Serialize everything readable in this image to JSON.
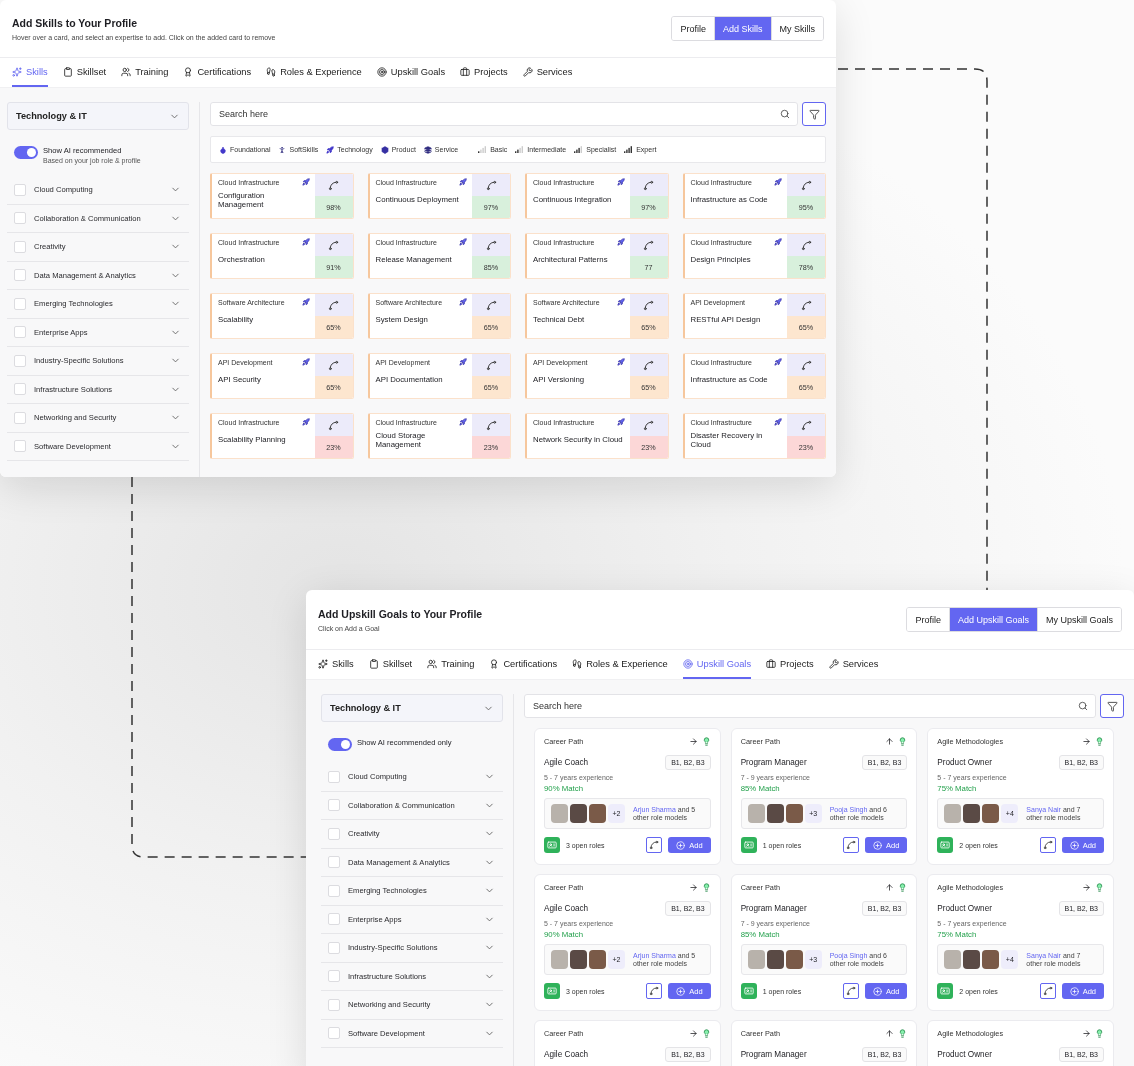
{
  "skills_window": {
    "title": "Add Skills to Your Profile",
    "subtitle": "Hover over a card, and select an expertise to add. Click on the added card to remove",
    "view_switch": [
      {
        "label": "Profile",
        "selected": false
      },
      {
        "label": "Add Skills",
        "selected": true
      },
      {
        "label": "My Skills",
        "selected": false
      }
    ],
    "tabs": [
      {
        "label": "Skills",
        "selected": true
      },
      {
        "label": "Skillset",
        "selected": false
      },
      {
        "label": "Training",
        "selected": false
      },
      {
        "label": "Certifications",
        "selected": false
      },
      {
        "label": "Roles & Experience",
        "selected": false
      },
      {
        "label": "Upskill Goals",
        "selected": false
      },
      {
        "label": "Projects",
        "selected": false
      },
      {
        "label": "Services",
        "selected": false
      }
    ],
    "sidebar": {
      "dropdown": "Technology & IT",
      "toggle": {
        "label": "Show AI recommended",
        "sublabel": "Based on your job role & profile",
        "on": true
      },
      "categories": [
        {
          "label": "Cloud Computing",
          "checked": false
        },
        {
          "label": "Collaboration & Communication",
          "checked": false
        },
        {
          "label": "Creativity",
          "checked": false
        },
        {
          "label": "Data Management & Analytics",
          "checked": false
        },
        {
          "label": "Emerging Technologies",
          "checked": false
        },
        {
          "label": "Enterprise Apps",
          "checked": false
        },
        {
          "label": "Industry-Specific Solutions",
          "checked": false
        },
        {
          "label": "Infrastructure Solutions",
          "checked": false
        },
        {
          "label": "Networking and Security",
          "checked": false
        },
        {
          "label": "Software Development",
          "checked": false
        }
      ]
    },
    "search": {
      "placeholder": "Search here"
    },
    "legend": {
      "types": [
        "Foundational",
        "SoftSkills",
        "Technology",
        "Product",
        "Service"
      ],
      "levels": [
        "Basic",
        "Intermediate",
        "Specialist",
        "Expert"
      ]
    },
    "cards": [
      {
        "category": "Cloud Infrastructure",
        "name": "Configuration Management",
        "score": "98%",
        "color": "#d8f0dc"
      },
      {
        "category": "Cloud Infrastructure",
        "name": "Continuous Deployment",
        "score": "97%",
        "color": "#d8f0dc"
      },
      {
        "category": "Cloud Infrastructure",
        "name": "Continuous Integration",
        "score": "97%",
        "color": "#d8f0dc"
      },
      {
        "category": "Cloud Infrastructure",
        "name": "Infrastructure as Code",
        "score": "95%",
        "color": "#d8f0dc"
      },
      {
        "category": "Cloud Infrastructure",
        "name": "Orchestration",
        "score": "91%",
        "color": "#d8f0dc"
      },
      {
        "category": "Cloud Infrastructure",
        "name": "Release Management",
        "score": "85%",
        "color": "#d8f0dc"
      },
      {
        "category": "Cloud Infrastructure",
        "name": "Architectural Patterns",
        "score": "77",
        "color": "#d8f0dc"
      },
      {
        "category": "Cloud Infrastructure",
        "name": "Design Principles",
        "score": "78%",
        "color": "#d8f0dc"
      },
      {
        "category": "Software Architecture",
        "name": "Scalability",
        "score": "65%",
        "color": "#fde6cf"
      },
      {
        "category": "Software Architecture",
        "name": "System Design",
        "score": "65%",
        "color": "#fde6cf"
      },
      {
        "category": "Software Architecture",
        "name": "Technical Debt",
        "score": "65%",
        "color": "#fde6cf"
      },
      {
        "category": "API Development",
        "name": "RESTful API Design",
        "score": "65%",
        "color": "#fde6cf"
      },
      {
        "category": "API Development",
        "name": "API Security",
        "score": "65%",
        "color": "#fde6cf"
      },
      {
        "category": "API Development",
        "name": "API Documentation",
        "score": "65%",
        "color": "#fde6cf"
      },
      {
        "category": "API Development",
        "name": "API Versioning",
        "score": "65%",
        "color": "#fde6cf"
      },
      {
        "category": "Cloud Infrastructure",
        "name": "Infrastructure as Code",
        "score": "65%",
        "color": "#fde6cf"
      },
      {
        "category": "Cloud Infrastructure",
        "name": "Scalability Planning",
        "score": "23%",
        "color": "#fcd7d7"
      },
      {
        "category": "Cloud Infrastructure",
        "name": "Cloud Storage Management",
        "score": "23%",
        "color": "#fcd7d7"
      },
      {
        "category": "Cloud Infrastructure",
        "name": "Network Security in Cloud",
        "score": "23%",
        "color": "#fcd7d7"
      },
      {
        "category": "Cloud Infrastructure",
        "name": "Disaster Recovery in Cloud",
        "score": "23%",
        "color": "#fcd7d7"
      }
    ]
  },
  "goals_window": {
    "title": "Add Upskill Goals to Your Profile",
    "subtitle": "Click on Add a Goal",
    "view_switch": [
      {
        "label": "Profile",
        "selected": false
      },
      {
        "label": "Add Upskill Goals",
        "selected": true
      },
      {
        "label": "My Upskill Goals",
        "selected": false
      }
    ],
    "tabs": [
      {
        "label": "Skills",
        "selected": false
      },
      {
        "label": "Skillset",
        "selected": false
      },
      {
        "label": "Training",
        "selected": false
      },
      {
        "label": "Certifications",
        "selected": false
      },
      {
        "label": "Roles & Experience",
        "selected": false
      },
      {
        "label": "Upskill Goals",
        "selected": true
      },
      {
        "label": "Projects",
        "selected": false
      },
      {
        "label": "Services",
        "selected": false
      }
    ],
    "sidebar": {
      "dropdown": "Technology & IT",
      "toggle": {
        "label": "Show AI recommended only",
        "on": true
      },
      "categories": [
        {
          "label": "Cloud Computing",
          "checked": false
        },
        {
          "label": "Collaboration & Communication",
          "checked": false
        },
        {
          "label": "Creativity",
          "checked": false
        },
        {
          "label": "Data Management & Analytics",
          "checked": false
        },
        {
          "label": "Emerging Technologies",
          "checked": false
        },
        {
          "label": "Enterprise Apps",
          "checked": false
        },
        {
          "label": "Industry-Specific Solutions",
          "checked": false
        },
        {
          "label": "Infrastructure Solutions",
          "checked": false
        },
        {
          "label": "Networking and Security",
          "checked": false
        },
        {
          "label": "Software Development",
          "checked": false
        }
      ]
    },
    "search": {
      "placeholder": "Search here"
    },
    "cards": [
      {
        "category": "Career Path",
        "upward": false,
        "title": "Agile Coach",
        "bands": "B1, B2, B3",
        "experience": "5 - 7 years experience",
        "match": "90% Match",
        "extra_count": "+2",
        "role_model": "Arjun Sharma",
        "role_model_rest": " and 5 other role models",
        "open_roles": "3 open roles",
        "add": "Add"
      },
      {
        "category": "Career Path",
        "upward": true,
        "title": "Program Manager",
        "bands": "B1, B2, B3",
        "experience": "7 - 9 years experience",
        "match": "85% Match",
        "extra_count": "+3",
        "role_model": "Pooja Singh",
        "role_model_rest": " and 6 other role models",
        "open_roles": "1 open roles",
        "add": "Add"
      },
      {
        "category": "Agile Methodologies",
        "upward": false,
        "title": "Product Owner",
        "bands": "B1, B2, B3",
        "experience": "5 - 7 years experience",
        "match": "75% Match",
        "extra_count": "+4",
        "role_model": "Sanya Nair",
        "role_model_rest": " and 7 other role models",
        "open_roles": "2 open roles",
        "add": "Add"
      },
      {
        "category": "Career Path",
        "upward": false,
        "title": "Agile Coach",
        "bands": "B1, B2, B3",
        "experience": "5 - 7 years experience",
        "match": "90% Match",
        "extra_count": "+2",
        "role_model": "Arjun Sharma",
        "role_model_rest": " and 5 other role models",
        "open_roles": "3 open roles",
        "add": "Add"
      },
      {
        "category": "Career Path",
        "upward": true,
        "title": "Program Manager",
        "bands": "B1, B2, B3",
        "experience": "7 - 9 years experience",
        "match": "85% Match",
        "extra_count": "+3",
        "role_model": "Pooja Singh",
        "role_model_rest": " and 6 other role models",
        "open_roles": "1 open roles",
        "add": "Add"
      },
      {
        "category": "Agile Methodologies",
        "upward": false,
        "title": "Product Owner",
        "bands": "B1, B2, B3",
        "experience": "5 - 7 years experience",
        "match": "75% Match",
        "extra_count": "+4",
        "role_model": "Sanya Nair",
        "role_model_rest": " and 7 other role models",
        "open_roles": "2 open roles",
        "add": "Add"
      },
      {
        "category": "Career Path",
        "upward": false,
        "title": "Agile Coach",
        "bands": "B1, B2, B3"
      },
      {
        "category": "Career Path",
        "upward": true,
        "title": "Program Manager",
        "bands": "B1, B2, B3"
      },
      {
        "category": "Agile Methodologies",
        "upward": false,
        "title": "Product Owner",
        "bands": "B1, B2, B3"
      }
    ]
  }
}
